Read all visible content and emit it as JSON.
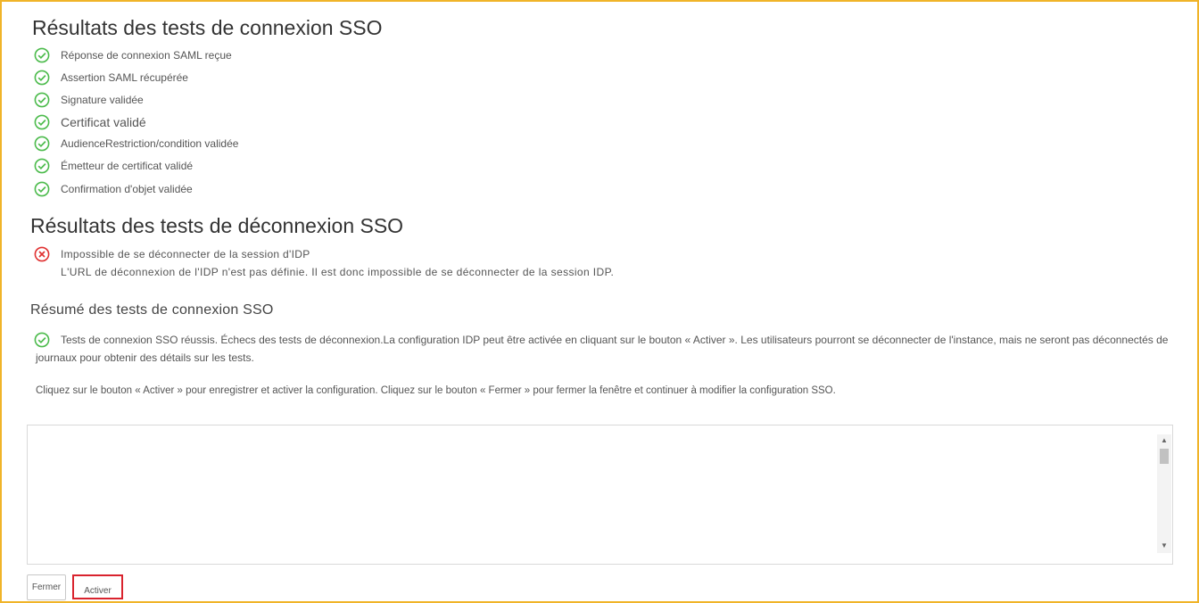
{
  "colors": {
    "frame_border": "#f0b429",
    "success": "#4cbb4c",
    "error": "#e03131",
    "highlight": "#d9232e"
  },
  "login_section": {
    "title": "Résultats des tests de connexion SSO",
    "items": [
      {
        "icon": "check-circle-icon",
        "label": "Réponse de connexion SAML reçue"
      },
      {
        "icon": "check-circle-icon",
        "label": "Assertion SAML récupérée"
      },
      {
        "icon": "check-circle-icon",
        "label": "Signature validée"
      },
      {
        "icon": "check-circle-icon",
        "label": "Certificat validé"
      },
      {
        "icon": "check-circle-icon",
        "label": "AudienceRestriction/condition validée"
      },
      {
        "icon": "check-circle-icon",
        "label": "Émetteur de certificat validé"
      },
      {
        "icon": "check-circle-icon",
        "label": "Confirmation d'objet validée"
      }
    ]
  },
  "logout_section": {
    "title": "Résultats des tests de déconnexion SSO",
    "error": {
      "icon": "error-circle-icon",
      "label": "Impossible de se déconnecter de la session d'IDP",
      "detail": "L'URL de déconnexion de l'IDP n'est pas définie. Il est donc impossible de se déconnecter de la session IDP."
    }
  },
  "summary": {
    "title": "Résumé des tests de connexion SSO",
    "icon": "check-circle-icon",
    "line1": "Tests de connexion SSO réussis. Échecs des tests de déconnexion.La configuration IDP peut être activée en cliquant sur le bouton « Activer ». Les utilisateurs pourront se déconnecter de l'instance, mais ne seront pas déconnectés de",
    "line2": "journaux pour obtenir des détails sur les tests.",
    "instructions": "Cliquez sur le bouton « Activer » pour enregistrer et activer la configuration. Cliquez sur le bouton « Fermer » pour fermer la fenêtre et continuer à modifier la configuration SSO."
  },
  "log_area": {
    "value": ""
  },
  "buttons": {
    "close_label": "Fermer",
    "activate_label": "Activer"
  }
}
